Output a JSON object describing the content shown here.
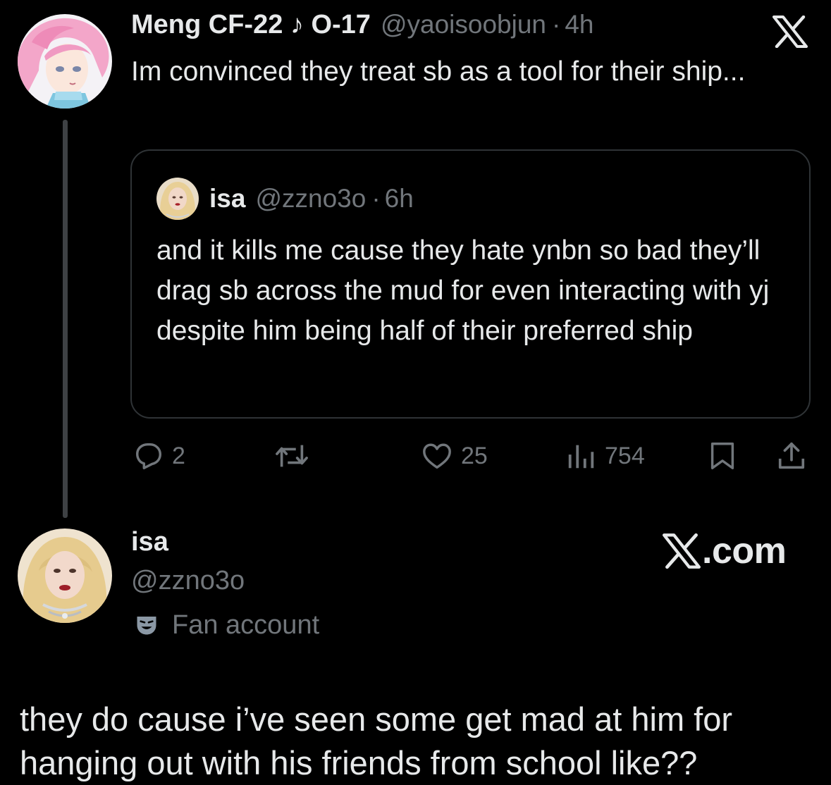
{
  "parent_tweet": {
    "author_name": "Meng CF-22 ♪ O-17",
    "handle": "@yaoisoobjun",
    "separator": "·",
    "time": "4h",
    "text": "Im convinced they treat sb as a tool for their ship...",
    "avatar": "avatar-pink-hair-illustration",
    "platform_icon": "x-logo-icon"
  },
  "quoted_tweet": {
    "author_name": "isa",
    "handle": "@zzno3o",
    "separator": "·",
    "time": "6h",
    "text": "and it kills me cause they hate ynbn so bad they’ll drag sb across the mud for even interacting with yj despite him being half of their preferred ship",
    "avatar": "avatar-blonde-photo"
  },
  "actions": {
    "reply_count": "2",
    "retweet_count": "",
    "like_count": "25",
    "views_count": "754",
    "icons": [
      "reply-icon",
      "retweet-icon",
      "like-icon",
      "views-icon",
      "bookmark-icon",
      "share-icon"
    ]
  },
  "reply_author": {
    "name": "isa",
    "handle": "@zzno3o",
    "label": "Fan account",
    "label_icon": "theater-mask-icon",
    "source_badge": ".com",
    "avatar": "avatar-blonde-photo"
  },
  "reply": {
    "text": "they do cause i’ve seen some get mad at him for hanging out with his friends from school like??"
  },
  "colors": {
    "background": "#000000",
    "text_primary": "#e7e9ea",
    "text_secondary": "#71767b",
    "border": "#2f3336",
    "thread_line": "#3e4144"
  }
}
